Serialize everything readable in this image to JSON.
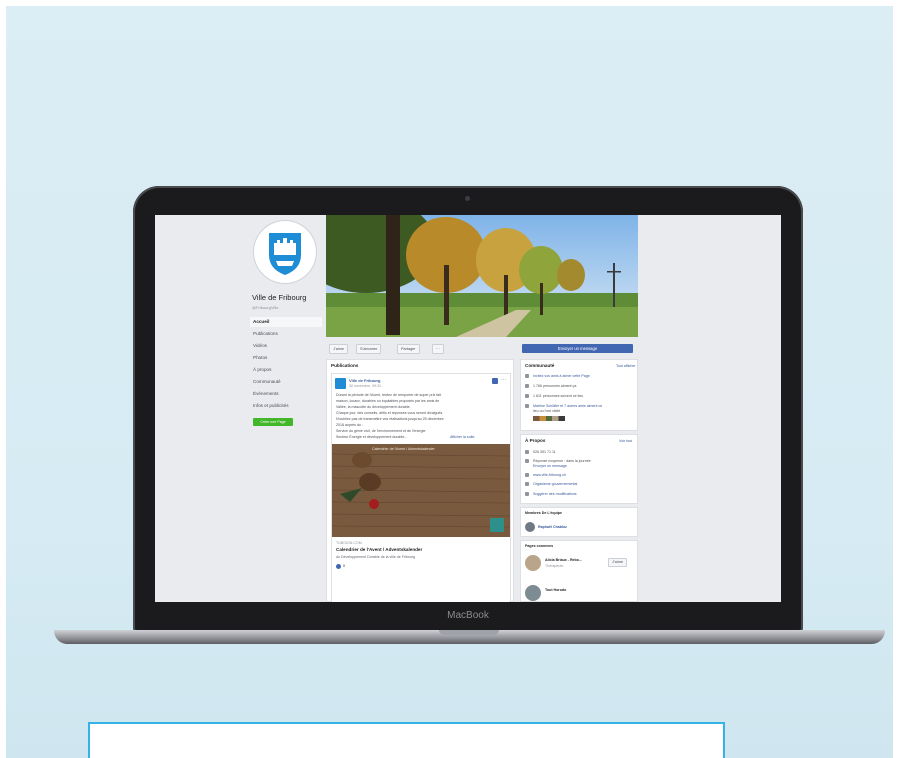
{
  "laptop": {
    "brand": "MacBook"
  },
  "fb": {
    "page_name": "Ville de Fribourg",
    "page_handle": "@FribourgVille",
    "nav": [
      "Accueil",
      "Publications",
      "Vidéos",
      "Photos",
      "À propos",
      "Communauté",
      "Évènements",
      "Infos et publicités"
    ],
    "create_page": "Créer une Page",
    "actions": {
      "like": "J’aime",
      "follow": "S’abonner",
      "share": "Partager",
      "more": "···",
      "message": "Envoyer un message"
    },
    "posts_title": "Publications",
    "post": {
      "author": "Ville de Fribourg",
      "date": "30 novembre, 09:31 ·",
      "lines": [
        "Durant la période de l'Avent, tentez de remporter de super prix fait",
        "maison, locaux, durables ou équitables proposés par les amis de",
        "Vallée, la mascotte du développement durable.",
        "Chaque jour, des conseils, défis et réponses vous seront divulgués",
        "N'oubliez pas de transmettre vos réalisations jusqu'au 25 décembre",
        "2018 auprès du :",
        "Service du génie civil, de l'environnement et de l'énergie",
        "Secteur Énergie et développement durable..."
      ],
      "see_more": "Afficher la suite",
      "image_caption": "Calendrier de l'Avent / Adventskalender",
      "link_domain": "TUBOIGN.COM",
      "link_title": "Calendrier de l'Avent / Adventskalender",
      "link_desc": "du Développement Durable de la ville de Fribourg",
      "reactions": "8"
    },
    "community": {
      "title": "Communauté",
      "see_all": "Tout afficher",
      "rows": [
        "Invitez vos amis à aimer cette Page",
        "1 766 personnes aiment ça",
        "1 811 personnes suivent ce lieu",
        "Martine Schläfer et 7 autres amis aiment ce",
        "lieu ou l'ont visité"
      ]
    },
    "about": {
      "title": "À Propos",
      "see_all": "Voir tout",
      "phone": "026 351 71 11",
      "response": "Réponse moyenne : dans la journée",
      "send_message": "Envoyer un message",
      "website": "www.ville-fribourg.ch",
      "category": "Organisme gouvernemental",
      "suggest": "Suggérer des modifications"
    },
    "team": {
      "title": "Membres De L'équipe",
      "member": "Raphaël Chabloz"
    },
    "related": {
      "title": "Pages connexes",
      "items": [
        {
          "name": "Alicia Briaux - Rebo...",
          "sub": "Thérapeute",
          "button": "J’aime"
        },
        {
          "name": "Tout Horodo",
          "sub": "",
          "button": ""
        }
      ]
    }
  },
  "colors": {
    "facebook_blue": "#4267b2",
    "green": "#42b72a",
    "caption_border": "#36b3e6"
  }
}
